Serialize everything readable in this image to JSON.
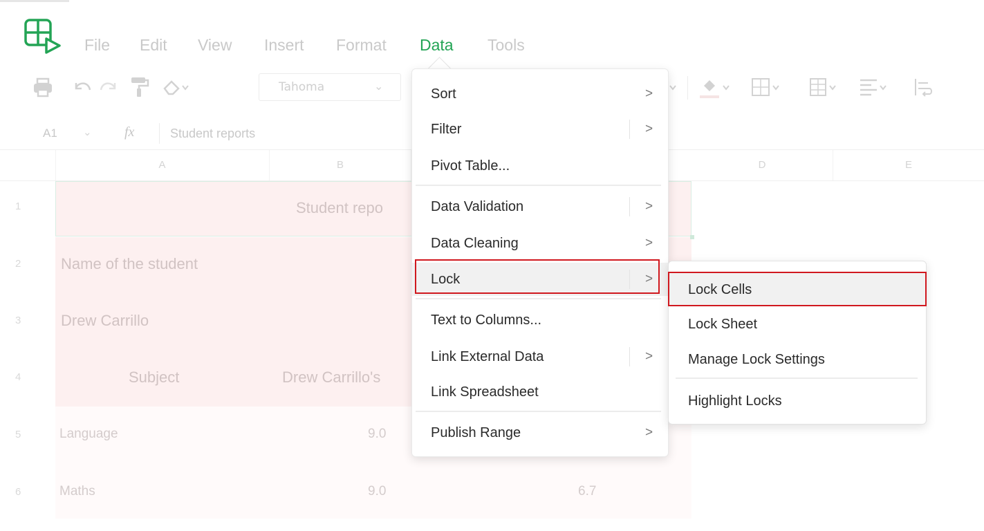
{
  "menubar": {
    "items": [
      "File",
      "Edit",
      "View",
      "Insert",
      "Format",
      "Data",
      "Tools"
    ],
    "active": "Data"
  },
  "toolbar": {
    "font_name": "Tahoma",
    "icons": [
      "print-icon",
      "undo-icon",
      "redo-icon",
      "paint-format-icon",
      "clear-format-icon",
      "fill-color-icon",
      "borders-icon",
      "merge-cells-icon",
      "align-icon",
      "wrap-text-icon"
    ]
  },
  "formula_bar": {
    "cell_ref": "A1",
    "fx": "fx",
    "value": "Student reports"
  },
  "grid": {
    "columns": [
      "A",
      "B",
      "D",
      "E"
    ],
    "rows": [
      "1",
      "2",
      "3",
      "4",
      "5",
      "6"
    ],
    "cells": {
      "r1_title": "Student repo",
      "r2_a": "Name of the student",
      "r3_a": "Drew Carrillo",
      "r4_a": "Subject",
      "r4_b": "Drew Carrillo's",
      "r5_a": "Language",
      "r5_b": "9.0",
      "r6_a": "Maths",
      "r6_b": "9.0",
      "r6_c": "6.7"
    },
    "colors": {
      "header_band": "#fdf0f0",
      "body_band": "#fffafa"
    }
  },
  "data_menu": {
    "items": [
      {
        "label": "Sort",
        "submenu": true
      },
      {
        "label": "Filter",
        "submenu": true
      },
      {
        "label": "Pivot Table..."
      },
      {
        "label": "Data Validation",
        "submenu": true
      },
      {
        "label": "Data Cleaning",
        "submenu": true
      },
      {
        "label": "Lock",
        "submenu": true,
        "highlighted": true
      },
      {
        "label": "Text to Columns..."
      },
      {
        "label": "Link External Data",
        "submenu": true
      },
      {
        "label": "Link Spreadsheet"
      },
      {
        "label": "Publish Range",
        "submenu": true
      }
    ],
    "arrow": ">"
  },
  "lock_submenu": {
    "items": [
      {
        "label": "Lock Cells",
        "highlighted": true
      },
      {
        "label": "Lock Sheet"
      },
      {
        "label": "Manage Lock Settings"
      },
      {
        "label": "Highlight Locks"
      }
    ]
  },
  "colors": {
    "accent": "#23a455",
    "highlight_box": "#d0181e"
  }
}
